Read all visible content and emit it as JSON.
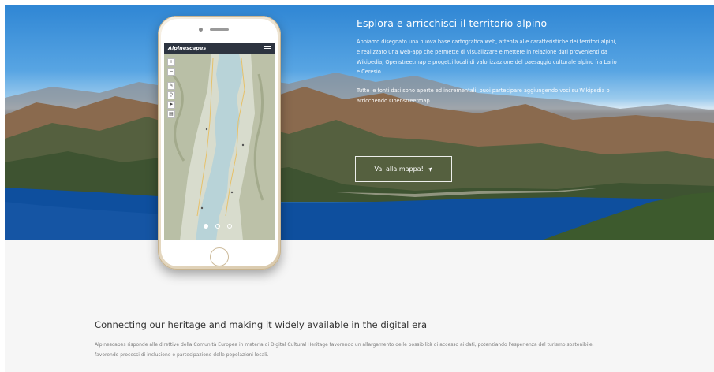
{
  "hero": {
    "title": "Esplora e arricchisci il territorio alpino",
    "paragraph_1": "Abbiamo disegnato una nuova base cartografica web, attenta alle caratteristiche dei territori alpini, e realizzato una web-app che permette di visualizzare e mettere in relazione dati provenienti da Wikipedia, Openstreetmap e progetti locali di valorizzazione del paesaggio culturale alpino fra Lario e Ceresio.",
    "paragraph_2": "Tutte le fonti dati sono aperte ed incrementali, puoi partecipare aggiungendo voci su Wikipedia o arricchendo Openstreetmap",
    "cta_label": "Vai alla mappa!",
    "cta_icon": "paper-plane-icon"
  },
  "phone_app": {
    "app_name": "Alpinescapes",
    "menu_icon": "hamburger-menu-icon",
    "tools": [
      {
        "name": "zoom-in-button",
        "glyph": "+"
      },
      {
        "name": "zoom-out-button",
        "glyph": "−"
      },
      {
        "name": "pencil-tool",
        "glyph": "✎"
      },
      {
        "name": "search-tool",
        "glyph": "⚲"
      },
      {
        "name": "locate-tool",
        "glyph": "➤"
      },
      {
        "name": "layers-tool",
        "glyph": "▤"
      }
    ],
    "carousel_dots": 3,
    "active_dot": 0
  },
  "section2": {
    "title": "Connecting our heritage and making it widely available in the digital era",
    "text": "Alpinescapes risponde alle direttive della Comunità Europea in materia di Digital Cultural Heritage favorendo un allargamento delle possibilità di accesso ai dati, potenziando l'esperienza del turismo sostenibile, favorendo processi di inclusione e partecipazione delle popolazioni locali."
  },
  "colors": {
    "app_bar": "#2d3440",
    "lake": "#0d4fa0",
    "band": "#f6f6f6"
  }
}
